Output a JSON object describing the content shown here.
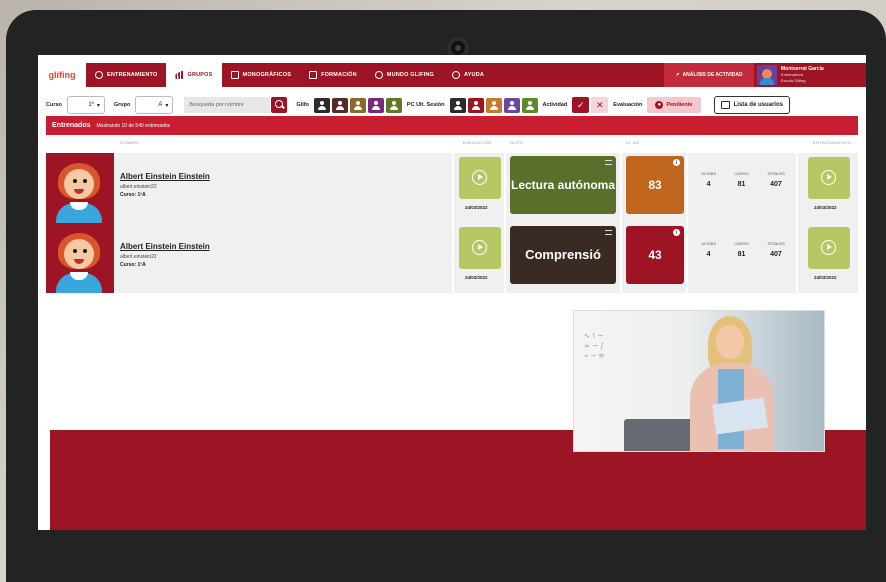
{
  "app": {
    "logo": "glifing",
    "nav": [
      {
        "label": "ENTRENAMIENTO",
        "icon": "cloud-icon",
        "active": false
      },
      {
        "label": "GRUPOS",
        "icon": "bar-chart-icon",
        "active": true
      },
      {
        "label": "MONOGRÁFICOS",
        "icon": "document-icon",
        "active": false
      },
      {
        "label": "FORMACIÓN",
        "icon": "video-icon",
        "active": false
      },
      {
        "label": "MUNDO GLIFING",
        "icon": "globe-icon",
        "active": false
      },
      {
        "label": "AYUDA",
        "icon": "help-icon",
        "active": false
      }
    ],
    "analysis_label": "ANÁLISIS DE ACTIVIDAD",
    "user": {
      "name": "Montserrat García",
      "role": "Entrenadora",
      "school": "Escola Glifing"
    }
  },
  "filters": {
    "curso_label": "Curso",
    "curso_value": "1º",
    "grupo_label": "Grupo",
    "grupo_value": "A",
    "search_placeholder": "Busqueda por nombre",
    "glifo_label": "Glifo",
    "pc_label": "PC Ult. Sesión",
    "actividad_label": "Actividad",
    "evaluacion_label": "Evaluación",
    "pendiente_label": "Pendiente",
    "users_button": "Lista de usuarios",
    "glifo_colors": [
      "#2b2b2b",
      "#5a2a2a",
      "#8a6a2a",
      "#7a2a7a",
      "#5d7a2a"
    ],
    "pc_colors": [
      "#2b2b2b",
      "#9d1425",
      "#c77a28",
      "#6b4a9e",
      "#5e8a2c"
    ]
  },
  "banner": {
    "title": "Entrenados",
    "text": "Mostrando 10 de 540 entrenados"
  },
  "columns": {
    "nombre": "NOMBRE",
    "evaluacion": "EVALUACIÓN",
    "glifo": "GLIFO",
    "cl_ms": "CL MS",
    "entrenamiento": "ENTRENAMIENTO"
  },
  "stats_headers": [
    "15 DÍAS",
    "CURSO",
    "TOTALES"
  ],
  "rows": [
    {
      "name": "Albert Einstein Einstein",
      "username": "albert.einstein22",
      "course_label": "Curso:",
      "course": "1ºA",
      "eval_date": "24/03/2022",
      "glifo_text": "Lectura autónoma",
      "glifo_color": "#5a6f2b",
      "cl_value": "83",
      "cl_color": "#c0661f",
      "stat_15": "4",
      "stat_curso": "81",
      "stat_total": "407",
      "train_date": "24/03/2022"
    },
    {
      "name": "Albert Einstein Einstein",
      "username": "albert.einstein22",
      "course_label": "Curso:",
      "course": "1ºA",
      "eval_date": "24/03/2022",
      "glifo_text": "Comprensió",
      "glifo_color": "#3a2a24",
      "cl_value": "43",
      "cl_color": "#9d1425",
      "stat_15": "4",
      "stat_curso": "81",
      "stat_total": "407",
      "train_date": "24/03/2022"
    }
  ]
}
